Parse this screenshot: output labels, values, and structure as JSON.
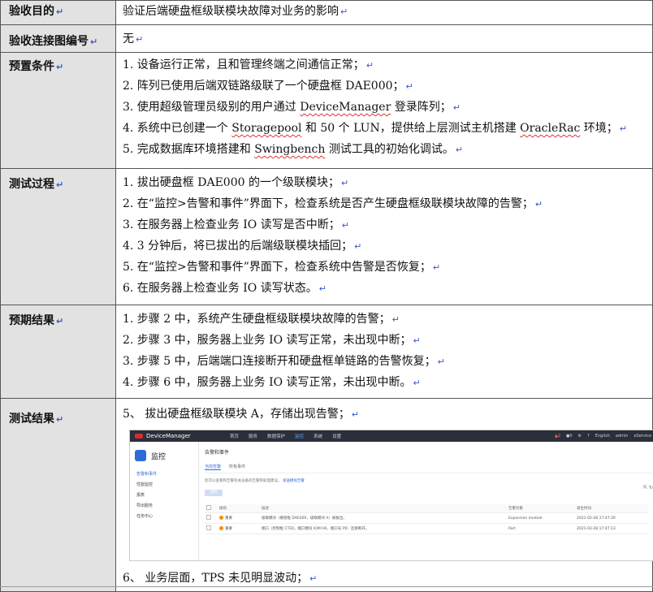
{
  "mark": "↵",
  "rows": {
    "purpose": {
      "label": "验收目的",
      "text": "验证后端硬盘框级联模块故障对业务的影响"
    },
    "diagram": {
      "label": "验收连接图编号",
      "text": "无"
    },
    "precond": {
      "label": "预置条件",
      "items": [
        "1.  设备运行正常，且和管理终端之间通信正常；",
        "2.  阵列已使用后端双链路级联了一个硬盘框 DAE000；",
        "3.  使用超级管理员级别的用户通过 ",
        "4.  系统中已创建一个 ",
        "5.  完成数据库环境搭建和 "
      ],
      "item3_word": "DeviceManager",
      "item3_tail": " 登录阵列；",
      "item4_word1": "Storagepool",
      "item4_mid": " 和 50 个 LUN，提供给上层测试主机搭建 ",
      "item4_word2": "OracleRac",
      "item4_tail": " 环境；",
      "item5_word": "Swingbench",
      "item5_tail": " 测试工具的初始化调试。"
    },
    "process": {
      "label": "测试过程",
      "items": [
        "1.  拔出硬盘框 DAE000 的一个级联模块；",
        "2.  在“监控>告警和事件”界面下，检查系统是否产生硬盘框级联模块故障的告警；",
        "3.  在服务器上检查业务 IO 读写是否中断；",
        "4.  3 分钟后，将已拔出的后端级联模块插回；",
        "5.  在“监控>告警和事件”界面下，检查系统中告警是否恢复；",
        "6.  在服务器上检查业务 IO 读写状态。"
      ]
    },
    "expected": {
      "label": "预期结果",
      "items": [
        "1.  步骤 2 中，系统产生硬盘框级联模块故障的告警；",
        "2.  步骤 3 中，服务器上业务 IO 读写正常，未出现中断；",
        "3.  步骤 5 中，后端端口连接断开和硬盘框单链路的告警恢复；",
        "4.  步骤 6 中，服务器上业务 IO 读写正常，未出现中断。"
      ]
    },
    "result": {
      "label": "测试结果",
      "line1": "5、 拔出硬盘框级联模块 A，存储出现告警；",
      "line2": "6、 业务层面，TPS 未见明显波动；"
    }
  },
  "screenshot": {
    "brand": "DeviceManager",
    "nav": [
      "首页",
      "服务",
      "数据保护",
      "监控",
      "系统",
      "设置"
    ],
    "active_nav": "监控",
    "right": [
      "▲2",
      "●0",
      "⚙",
      "?",
      "English",
      "admin",
      "eService"
    ],
    "sidebar_title": "监控",
    "sidebar_items": [
      "告警和事件",
      "性能监控",
      "报表",
      "导出服务",
      "任务中心"
    ],
    "page_title": "告警和事件",
    "tabs": [
      "当前告警",
      "所有事件"
    ],
    "hint": "您可以查看和告警有关设备的告警和处理建议。",
    "hint_link": "发送模拟告警",
    "clear_button": "清除",
    "table_headers": [
      "级别",
      "描述",
      "告警对象",
      "发生时间"
    ],
    "table_rows": [
      {
        "level": "重要",
        "desc": "级联模块（硬盘框 DAE000，级联模块 A）被拔出。",
        "object": "Expansion module",
        "time": "2021-02-28 17:47:20"
      },
      {
        "level": "重要",
        "desc": "端口（控制框 CTE0，端口模块 IOM H6，端口号 P0）连接断开。",
        "object": "Port",
        "time": "2021-02-28 17:47:13"
      }
    ]
  }
}
